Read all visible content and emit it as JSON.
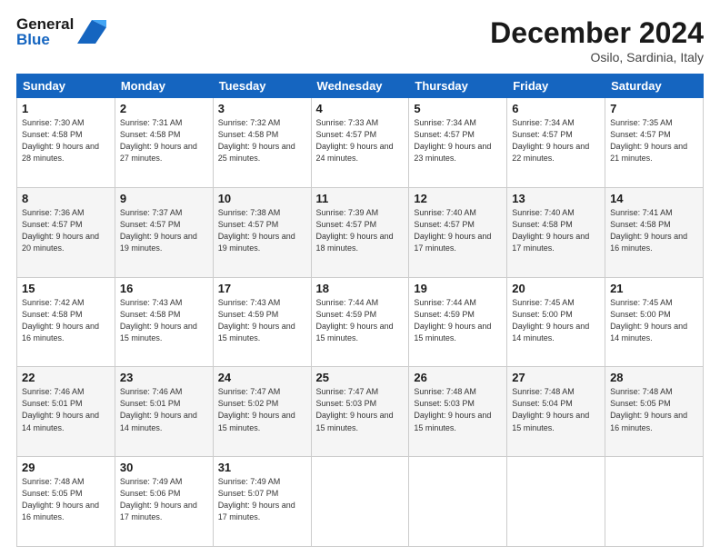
{
  "header": {
    "logo_line1": "General",
    "logo_line2": "Blue",
    "month_title": "December 2024",
    "location": "Osilo, Sardinia, Italy"
  },
  "weekdays": [
    "Sunday",
    "Monday",
    "Tuesday",
    "Wednesday",
    "Thursday",
    "Friday",
    "Saturday"
  ],
  "weeks": [
    [
      {
        "day": "1",
        "sunrise": "Sunrise: 7:30 AM",
        "sunset": "Sunset: 4:58 PM",
        "daylight": "Daylight: 9 hours and 28 minutes."
      },
      {
        "day": "2",
        "sunrise": "Sunrise: 7:31 AM",
        "sunset": "Sunset: 4:58 PM",
        "daylight": "Daylight: 9 hours and 27 minutes."
      },
      {
        "day": "3",
        "sunrise": "Sunrise: 7:32 AM",
        "sunset": "Sunset: 4:58 PM",
        "daylight": "Daylight: 9 hours and 25 minutes."
      },
      {
        "day": "4",
        "sunrise": "Sunrise: 7:33 AM",
        "sunset": "Sunset: 4:57 PM",
        "daylight": "Daylight: 9 hours and 24 minutes."
      },
      {
        "day": "5",
        "sunrise": "Sunrise: 7:34 AM",
        "sunset": "Sunset: 4:57 PM",
        "daylight": "Daylight: 9 hours and 23 minutes."
      },
      {
        "day": "6",
        "sunrise": "Sunrise: 7:34 AM",
        "sunset": "Sunset: 4:57 PM",
        "daylight": "Daylight: 9 hours and 22 minutes."
      },
      {
        "day": "7",
        "sunrise": "Sunrise: 7:35 AM",
        "sunset": "Sunset: 4:57 PM",
        "daylight": "Daylight: 9 hours and 21 minutes."
      }
    ],
    [
      {
        "day": "8",
        "sunrise": "Sunrise: 7:36 AM",
        "sunset": "Sunset: 4:57 PM",
        "daylight": "Daylight: 9 hours and 20 minutes."
      },
      {
        "day": "9",
        "sunrise": "Sunrise: 7:37 AM",
        "sunset": "Sunset: 4:57 PM",
        "daylight": "Daylight: 9 hours and 19 minutes."
      },
      {
        "day": "10",
        "sunrise": "Sunrise: 7:38 AM",
        "sunset": "Sunset: 4:57 PM",
        "daylight": "Daylight: 9 hours and 19 minutes."
      },
      {
        "day": "11",
        "sunrise": "Sunrise: 7:39 AM",
        "sunset": "Sunset: 4:57 PM",
        "daylight": "Daylight: 9 hours and 18 minutes."
      },
      {
        "day": "12",
        "sunrise": "Sunrise: 7:40 AM",
        "sunset": "Sunset: 4:57 PM",
        "daylight": "Daylight: 9 hours and 17 minutes."
      },
      {
        "day": "13",
        "sunrise": "Sunrise: 7:40 AM",
        "sunset": "Sunset: 4:58 PM",
        "daylight": "Daylight: 9 hours and 17 minutes."
      },
      {
        "day": "14",
        "sunrise": "Sunrise: 7:41 AM",
        "sunset": "Sunset: 4:58 PM",
        "daylight": "Daylight: 9 hours and 16 minutes."
      }
    ],
    [
      {
        "day": "15",
        "sunrise": "Sunrise: 7:42 AM",
        "sunset": "Sunset: 4:58 PM",
        "daylight": "Daylight: 9 hours and 16 minutes."
      },
      {
        "day": "16",
        "sunrise": "Sunrise: 7:43 AM",
        "sunset": "Sunset: 4:58 PM",
        "daylight": "Daylight: 9 hours and 15 minutes."
      },
      {
        "day": "17",
        "sunrise": "Sunrise: 7:43 AM",
        "sunset": "Sunset: 4:59 PM",
        "daylight": "Daylight: 9 hours and 15 minutes."
      },
      {
        "day": "18",
        "sunrise": "Sunrise: 7:44 AM",
        "sunset": "Sunset: 4:59 PM",
        "daylight": "Daylight: 9 hours and 15 minutes."
      },
      {
        "day": "19",
        "sunrise": "Sunrise: 7:44 AM",
        "sunset": "Sunset: 4:59 PM",
        "daylight": "Daylight: 9 hours and 15 minutes."
      },
      {
        "day": "20",
        "sunrise": "Sunrise: 7:45 AM",
        "sunset": "Sunset: 5:00 PM",
        "daylight": "Daylight: 9 hours and 14 minutes."
      },
      {
        "day": "21",
        "sunrise": "Sunrise: 7:45 AM",
        "sunset": "Sunset: 5:00 PM",
        "daylight": "Daylight: 9 hours and 14 minutes."
      }
    ],
    [
      {
        "day": "22",
        "sunrise": "Sunrise: 7:46 AM",
        "sunset": "Sunset: 5:01 PM",
        "daylight": "Daylight: 9 hours and 14 minutes."
      },
      {
        "day": "23",
        "sunrise": "Sunrise: 7:46 AM",
        "sunset": "Sunset: 5:01 PM",
        "daylight": "Daylight: 9 hours and 14 minutes."
      },
      {
        "day": "24",
        "sunrise": "Sunrise: 7:47 AM",
        "sunset": "Sunset: 5:02 PM",
        "daylight": "Daylight: 9 hours and 15 minutes."
      },
      {
        "day": "25",
        "sunrise": "Sunrise: 7:47 AM",
        "sunset": "Sunset: 5:03 PM",
        "daylight": "Daylight: 9 hours and 15 minutes."
      },
      {
        "day": "26",
        "sunrise": "Sunrise: 7:48 AM",
        "sunset": "Sunset: 5:03 PM",
        "daylight": "Daylight: 9 hours and 15 minutes."
      },
      {
        "day": "27",
        "sunrise": "Sunrise: 7:48 AM",
        "sunset": "Sunset: 5:04 PM",
        "daylight": "Daylight: 9 hours and 15 minutes."
      },
      {
        "day": "28",
        "sunrise": "Sunrise: 7:48 AM",
        "sunset": "Sunset: 5:05 PM",
        "daylight": "Daylight: 9 hours and 16 minutes."
      }
    ],
    [
      {
        "day": "29",
        "sunrise": "Sunrise: 7:48 AM",
        "sunset": "Sunset: 5:05 PM",
        "daylight": "Daylight: 9 hours and 16 minutes."
      },
      {
        "day": "30",
        "sunrise": "Sunrise: 7:49 AM",
        "sunset": "Sunset: 5:06 PM",
        "daylight": "Daylight: 9 hours and 17 minutes."
      },
      {
        "day": "31",
        "sunrise": "Sunrise: 7:49 AM",
        "sunset": "Sunset: 5:07 PM",
        "daylight": "Daylight: 9 hours and 17 minutes."
      },
      null,
      null,
      null,
      null
    ]
  ]
}
